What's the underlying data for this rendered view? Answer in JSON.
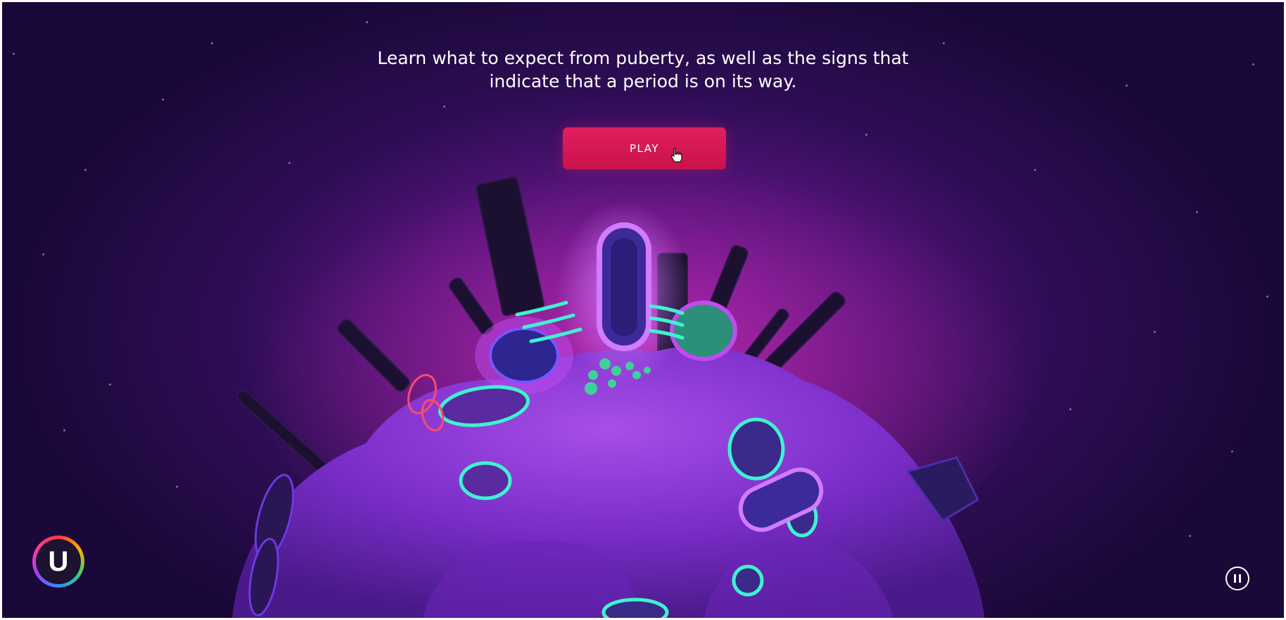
{
  "intro": {
    "line1": "Learn what to expect from puberty, as well as the signs that",
    "line2": "indicate that a period is on its way."
  },
  "play_button": {
    "label": "PLAY"
  },
  "logo": {
    "letter": "U"
  },
  "icons": {
    "cursor": "hand-pointer-icon",
    "pause": "pause-icon",
    "logo": "u-by-kotex-logo"
  },
  "colors": {
    "accent": "#d4174f",
    "background": "#2e0d55",
    "glow": "#8e1fa8",
    "neon_cyan": "#3ff2d0"
  }
}
